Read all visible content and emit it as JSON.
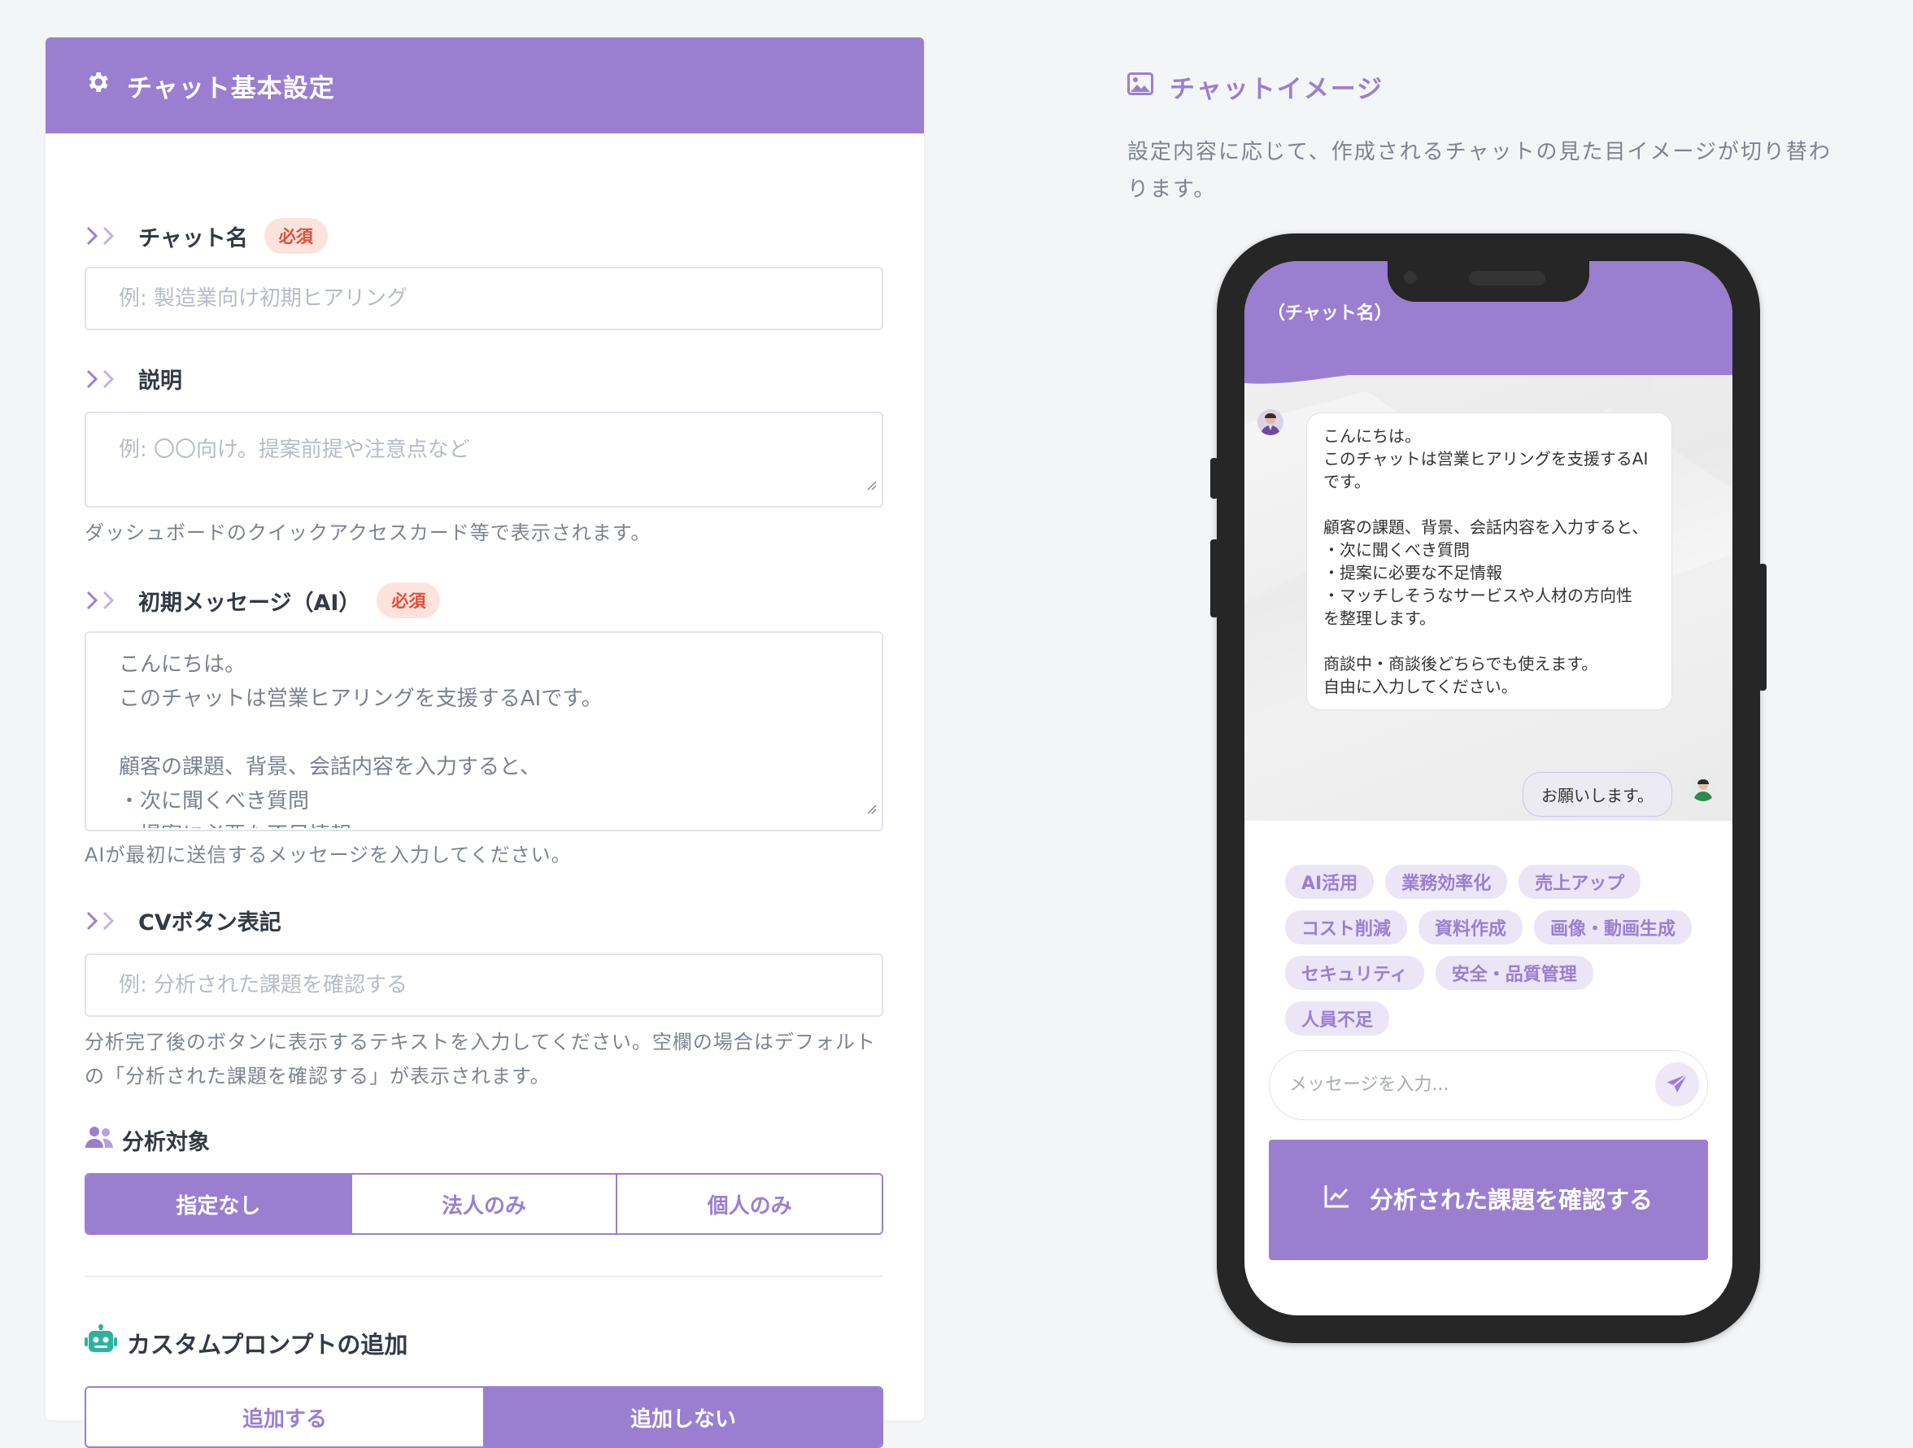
{
  "settings": {
    "header_title": "チャット基本設定",
    "chat_name": {
      "label": "チャット名",
      "badge": "必須",
      "placeholder": "例: 製造業向け初期ヒアリング"
    },
    "description": {
      "label": "説明",
      "placeholder": "例: 〇〇向け。提案前提や注意点など",
      "help": "ダッシュボードのクイックアクセスカード等で表示されます。"
    },
    "initial_message": {
      "label": "初期メッセージ（AI）",
      "badge": "必須",
      "value": "こんにちは。\nこのチャットは営業ヒアリングを支援するAIです。\n\n顧客の課題、背景、会話内容を入力すると、\n・次に聞くべき質問\n・提案に必要な不足情報",
      "help": "AIが最初に送信するメッセージを入力してください。"
    },
    "cv_button": {
      "label": "CVボタン表記",
      "placeholder": "例: 分析された課題を確認する",
      "help": "分析完了後のボタンに表示するテキストを入力してください。空欄の場合はデフォルトの「分析された課題を確認する」が表示されます。"
    },
    "analysis_target": {
      "label": "分析対象",
      "options": [
        "指定なし",
        "法人のみ",
        "個人のみ"
      ],
      "selected": "指定なし"
    },
    "custom_prompt": {
      "label": "カスタムプロンプトの追加",
      "options": [
        "追加する",
        "追加しない"
      ],
      "selected": "追加しない"
    }
  },
  "preview": {
    "title": "チャットイメージ",
    "description": "設定内容に応じて、作成されるチャットの見た目イメージが切り替わります。",
    "chat_title": "（チャット名）",
    "ai_message": "こんにちは。\nこのチャットは営業ヒアリングを支援するAIです。\n\n顧客の課題、背景、会話内容を入力すると、\n・次に聞くべき質問\n・提案に必要な不足情報\n・マッチしそうなサービスや人材の方向性\nを整理します。\n\n商談中・商談後どちらでも使えます。\n自由に入力してください。",
    "user_message": "お願いします。",
    "tags": [
      "AI活用",
      "業務効率化",
      "売上アップ",
      "コスト削減",
      "資料作成",
      "画像・動画生成",
      "セキュリティ",
      "安全・品質管理",
      "人員不足"
    ],
    "input_placeholder": "メッセージを入力...",
    "cv_button_label": "分析された課題を確認する"
  },
  "colors": {
    "accent": "#9a7fd1",
    "badge_bg": "#fde3dc",
    "badge_text": "#d9503a",
    "robot": "#2bb3a0"
  }
}
